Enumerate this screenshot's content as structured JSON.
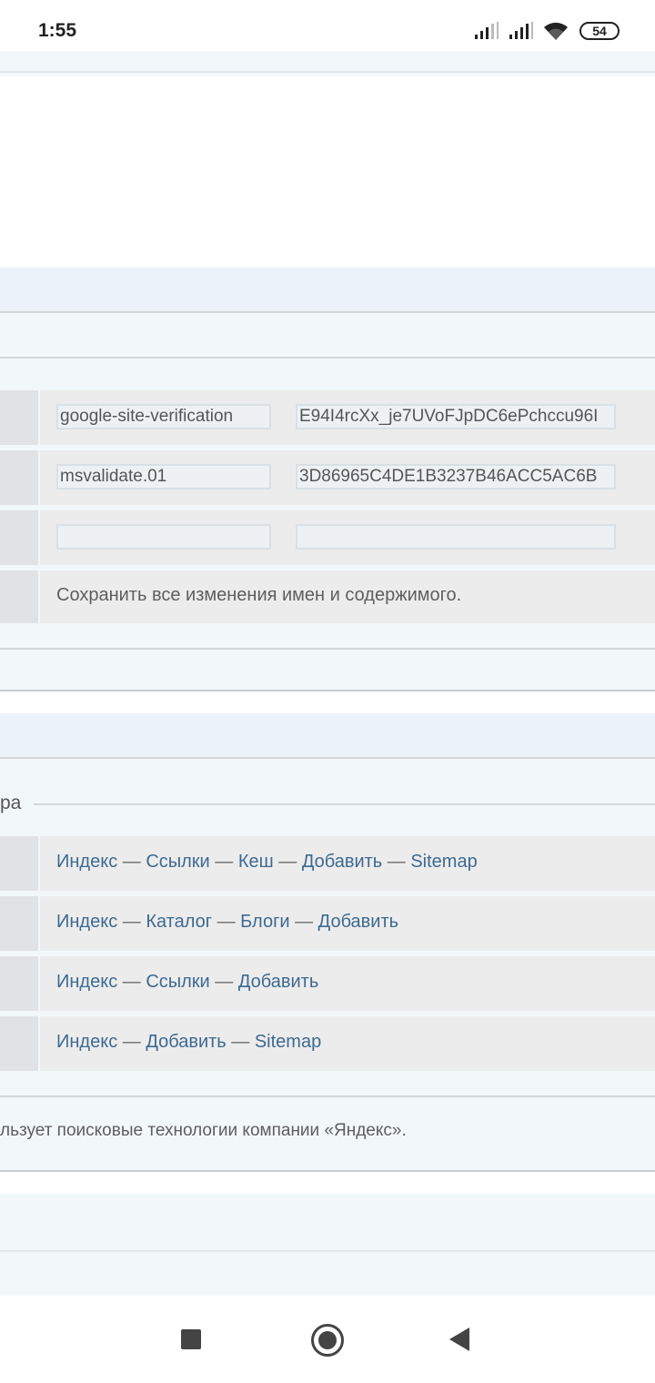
{
  "status_bar": {
    "time": "1:55",
    "battery": "54"
  },
  "meta_rows": [
    {
      "name": "google-site-verification",
      "content": "E94I4rcXx_je7UVoFJpDC6ePchccu96I"
    },
    {
      "name": "msvalidate.01",
      "content": "3D86965C4DE1B3237B46ACC5AC6B"
    },
    {
      "name": "",
      "content": ""
    }
  ],
  "save_hint": "Сохранить все изменения имен и содержимого.",
  "section_legend": "ра",
  "link_rows": [
    {
      "links": [
        "Индекс",
        "Ссылки",
        "Кеш",
        "Добавить",
        "Sitemap"
      ]
    },
    {
      "links": [
        "Индекс",
        "Каталог",
        "Блоги",
        "Добавить"
      ]
    },
    {
      "links": [
        "Индекс",
        "Ссылки",
        "Добавить"
      ]
    },
    {
      "links": [
        "Индекс",
        "Добавить",
        "Sitemap"
      ]
    }
  ],
  "link_separator": " — ",
  "footer_text": "льзует поисковые технологии компании «Яндекс».",
  "nav": {
    "recents": "square-icon",
    "home": "circle-icon",
    "back": "triangle-back-icon"
  }
}
